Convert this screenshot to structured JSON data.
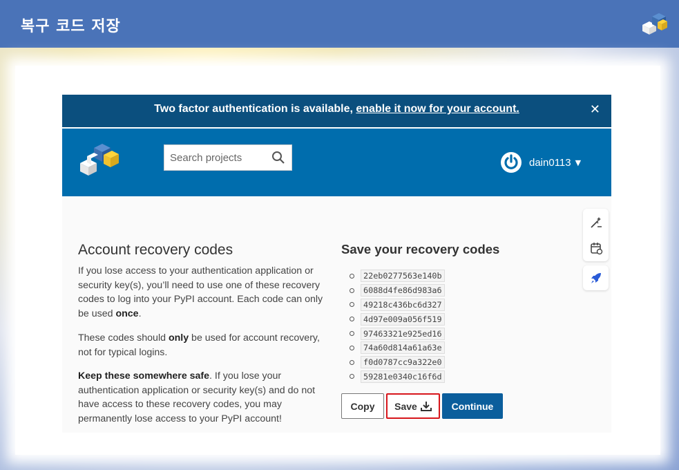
{
  "outer": {
    "title": "복구 코드 저장",
    "logo_icon": "pypi-logo-icon"
  },
  "banner": {
    "text_prefix": "Two factor authentication is available, ",
    "link_text": "enable it now for your account.",
    "close_label": "✕"
  },
  "header": {
    "search_placeholder": "Search projects",
    "username": "dain0113",
    "caret": "▼"
  },
  "left": {
    "title": "Account recovery codes",
    "p1_a": "If you lose access to your authentication application or security key(s), you’ll need to use one of these recovery codes to log into your PyPI account. Each code can only be used ",
    "p1_b": "once",
    "p1_c": ".",
    "p2_a": "These codes should ",
    "p2_b": "only",
    "p2_c": " be used for account recovery, not for typical logins.",
    "p3_a": "Keep these somewhere safe",
    "p3_b": ". If you lose your authentication application or security key(s) and do not have access to these recovery codes, you may permanently lose access to your PyPI account!"
  },
  "right": {
    "title": "Save your recovery codes",
    "codes": [
      "22eb0277563e140b",
      "6088d4fe86d983a6",
      "49218c436bc6d327",
      "4d97e009a056f519",
      "97463321e925ed16",
      "74a60d814a61a63e",
      "f0d0787cc9a322e0",
      "59281e0340c16f6d"
    ]
  },
  "buttons": {
    "copy": "Copy",
    "save": "Save",
    "continue": "Continue"
  },
  "colors": {
    "banner": "#0b4f7e",
    "header": "#006dad",
    "continue": "#0b5e9c",
    "highlight": "#d7151b"
  }
}
